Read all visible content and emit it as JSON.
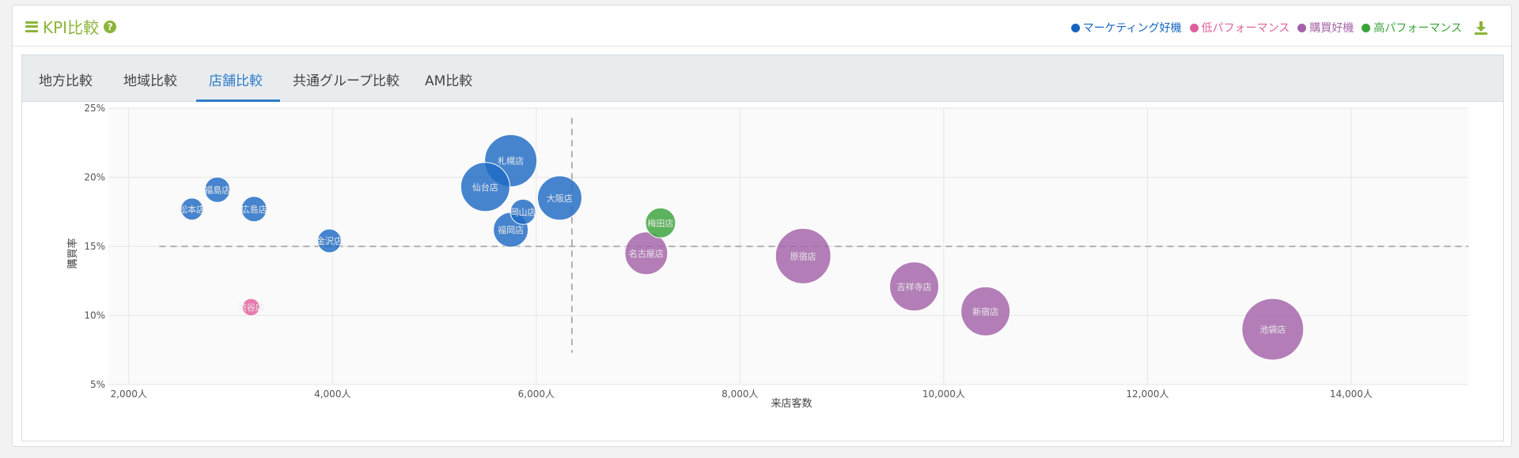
{
  "header": {
    "title": "KPI比較",
    "legend": [
      {
        "label": "マーケティング好機",
        "color": "#1565c0"
      },
      {
        "label": "低パフォーマンス",
        "color": "#e0609e"
      },
      {
        "label": "購買好機",
        "color": "#a463a8"
      },
      {
        "label": "高パフォーマンス",
        "color": "#3aa33a"
      }
    ]
  },
  "tabs": [
    {
      "label": "地方比較",
      "active": false
    },
    {
      "label": "地域比較",
      "active": false
    },
    {
      "label": "店舗比較",
      "active": true
    },
    {
      "label": "共通グループ比較",
      "active": false
    },
    {
      "label": "AM比較",
      "active": false
    }
  ],
  "chart_data": {
    "type": "scatter",
    "xlabel": "来店客数",
    "ylabel": "購買率",
    "xlim": [
      1800,
      15150
    ],
    "ylim": [
      5,
      25
    ],
    "x_ticks": [
      2000,
      4000,
      6000,
      8000,
      10000,
      12000,
      14000
    ],
    "x_tick_labels": [
      "2,000人",
      "4,000人",
      "6,000人",
      "8,000人",
      "10,000人",
      "12,000人",
      "14,000人"
    ],
    "y_ticks": [
      5,
      10,
      15,
      20,
      25
    ],
    "y_tick_labels": [
      "5%",
      "10%",
      "15%",
      "20%",
      "25%"
    ],
    "reference_lines": {
      "x": 6350,
      "y": 15
    },
    "grid": true,
    "categories": {
      "marketing": {
        "color": "#1f6ac4"
      },
      "low": {
        "color": "#e0609e"
      },
      "purchase": {
        "color": "#a463a8"
      },
      "high": {
        "color": "#3aa33a"
      }
    },
    "points": [
      {
        "name": "札幌店",
        "x": 5750,
        "y": 21.2,
        "size": 33,
        "category": "marketing"
      },
      {
        "name": "仙台店",
        "x": 5500,
        "y": 19.3,
        "size": 31,
        "category": "marketing"
      },
      {
        "name": "大阪店",
        "x": 6230,
        "y": 18.5,
        "size": 28,
        "category": "marketing"
      },
      {
        "name": "福岡店",
        "x": 5750,
        "y": 16.2,
        "size": 22,
        "category": "marketing"
      },
      {
        "name": "岡山店",
        "x": 5870,
        "y": 17.5,
        "size": 16,
        "category": "marketing"
      },
      {
        "name": "福島店",
        "x": 2870,
        "y": 19.1,
        "size": 16,
        "category": "marketing"
      },
      {
        "name": "広島店",
        "x": 3230,
        "y": 17.7,
        "size": 16,
        "category": "marketing"
      },
      {
        "name": "松本店",
        "x": 2620,
        "y": 17.7,
        "size": 14,
        "category": "marketing"
      },
      {
        "name": "金沢店",
        "x": 3970,
        "y": 15.4,
        "size": 15,
        "category": "marketing"
      },
      {
        "name": "渋谷店",
        "x": 3200,
        "y": 10.6,
        "size": 11,
        "category": "low"
      },
      {
        "name": "梅田店",
        "x": 7220,
        "y": 16.7,
        "size": 19,
        "category": "high"
      },
      {
        "name": "名古屋店",
        "x": 7080,
        "y": 14.5,
        "size": 27,
        "category": "purchase"
      },
      {
        "name": "原宿店",
        "x": 8620,
        "y": 14.3,
        "size": 35,
        "category": "purchase"
      },
      {
        "name": "吉祥寺店",
        "x": 9710,
        "y": 12.1,
        "size": 31,
        "category": "purchase"
      },
      {
        "name": "新宿店",
        "x": 10410,
        "y": 10.3,
        "size": 31,
        "category": "purchase"
      },
      {
        "name": "池袋店",
        "x": 13230,
        "y": 9.0,
        "size": 39,
        "category": "purchase"
      }
    ]
  }
}
